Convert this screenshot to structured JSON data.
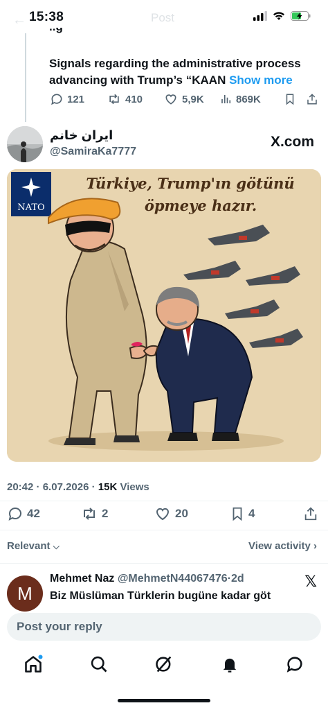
{
  "status_bar": {
    "time": "15:38",
    "faded_title": "Post"
  },
  "quoted_post": {
    "text": "Signals regarding the administrative process advancing with Trump’s “KAAN",
    "show_more": "Show more",
    "replies": "121",
    "reposts": "410",
    "likes": "5,9K",
    "views": "869K"
  },
  "post": {
    "author_name": "ایران خانم",
    "author_handle": "@SamiraKa7777",
    "source_logo": "X.com",
    "image": {
      "caption_line1": "Türkiye, Trump'ın götünü",
      "caption_line2": "öpmeye hazır.",
      "nato_label": "NATO"
    },
    "time": "20:42",
    "date": "6.07.2026",
    "views_count": "15K",
    "views_label": "Views",
    "replies": "42",
    "reposts": "2",
    "likes": "20",
    "bookmarks": "4"
  },
  "sort": {
    "label": "Relevant",
    "view_activity": "View activity"
  },
  "reply": {
    "avatar_letter": "M",
    "name": "Mehmet Naz",
    "handle": "@MehmetN44067476",
    "age": "2d",
    "text": "Biz Müslüman Türklerin bugüne kadar göt"
  },
  "composer": {
    "placeholder": "Post your reply"
  },
  "colors": {
    "accent": "#1d9bf0",
    "muted": "#536471",
    "text": "#0f1419"
  }
}
